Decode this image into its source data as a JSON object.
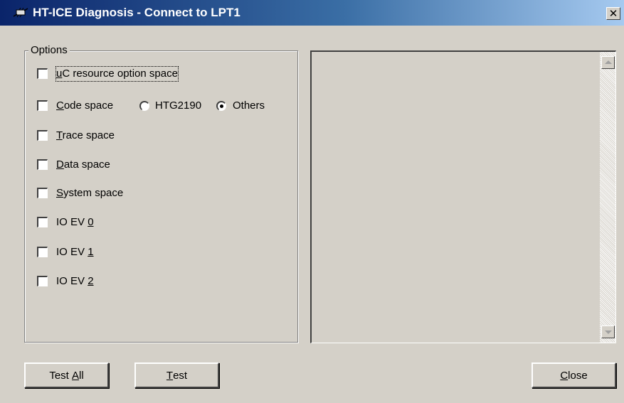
{
  "window": {
    "title": "HT-ICE Diagnosis - Connect to LPT1",
    "close_glyph": "✕"
  },
  "options": {
    "group_title": "Options",
    "items": [
      {
        "label_pre": "",
        "label_mnemonic": "u",
        "label_post": "C resource option space",
        "checked": false
      },
      {
        "label_pre": "",
        "label_mnemonic": "C",
        "label_post": "ode space",
        "checked": false
      },
      {
        "label_pre": "",
        "label_mnemonic": "T",
        "label_post": "race space",
        "checked": false
      },
      {
        "label_pre": "",
        "label_mnemonic": "D",
        "label_post": "ata space",
        "checked": false
      },
      {
        "label_pre": "",
        "label_mnemonic": "S",
        "label_post": "ystem space",
        "checked": false
      },
      {
        "label_pre": "IO EV ",
        "label_mnemonic": "0",
        "label_post": "",
        "checked": false
      },
      {
        "label_pre": "IO EV ",
        "label_mnemonic": "1",
        "label_post": "",
        "checked": false
      },
      {
        "label_pre": "IO EV ",
        "label_mnemonic": "2",
        "label_post": "",
        "checked": false
      }
    ],
    "code_space_radios": [
      {
        "label": "HTG2190",
        "selected": false
      },
      {
        "label": "Others",
        "selected": true
      }
    ]
  },
  "buttons": {
    "test_all": {
      "pre": "Test ",
      "mnemonic": "A",
      "post": "ll"
    },
    "test": {
      "pre": "",
      "mnemonic": "T",
      "post": "est"
    },
    "close": {
      "pre": "",
      "mnemonic": "C",
      "post": "lose"
    }
  },
  "icons": {
    "app": "app-icon",
    "close": "close-icon",
    "scroll_up": "scroll-up-arrow-icon",
    "scroll_down": "scroll-down-arrow-icon"
  },
  "colors": {
    "title_start": "#0a246a",
    "title_end": "#a6caf0",
    "face": "#d4d0c8"
  }
}
